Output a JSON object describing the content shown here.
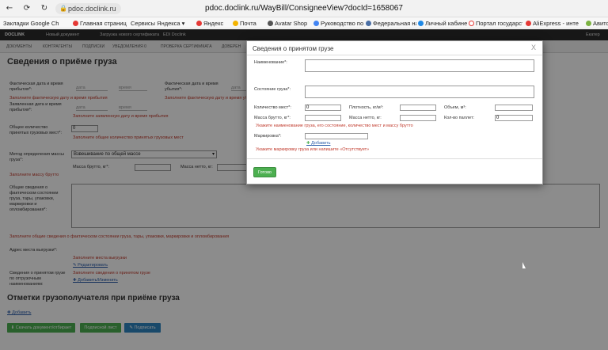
{
  "browser": {
    "host_badge": "pdoc.doclink.ru",
    "url": "pdoc.doclink.ru/WayBill/ConsigneeView?docId=1658067",
    "bookmarks": [
      {
        "label": "Закладки Google Ch",
        "color": "#ffffff"
      },
      {
        "label": "Главная страница",
        "color": "#e53935"
      },
      {
        "label": "Сервисы Яндекса",
        "color": "#ffffff"
      },
      {
        "label": "Яндекс",
        "color": "#e53935"
      },
      {
        "label": "Почта",
        "color": "#f4b400"
      },
      {
        "label": "Avatar Shop",
        "color": "#555555"
      },
      {
        "label": "Руководство по э",
        "color": "#4285f4"
      },
      {
        "label": "Федеральная нал",
        "color": "#4a6fa5"
      },
      {
        "label": "Личный кабинет",
        "color": "#1e88e5"
      },
      {
        "label": "Портал государст",
        "color": "#ffffff"
      },
      {
        "label": "AliExpress - инте",
        "color": "#e53935"
      },
      {
        "label": "Авито",
        "color": "#7cb342"
      }
    ]
  },
  "app": {
    "logo": "DOCLINK",
    "top_links": [
      "Новый документ",
      "Загрузка нового сертификата",
      "EDI Doclink"
    ],
    "user": "Екатер",
    "tabs": [
      "Документы",
      "Контрагенты",
      "Подписки",
      "Уведомления 0",
      "Проверка сертификата",
      "Доверен"
    ]
  },
  "page": {
    "title": "Сведения о приёме груза",
    "arrival_actual_label": "Фактическая дата и время прибытия*:",
    "date_ph": "дата",
    "time_ph": "время",
    "departure_actual_label": "Фактическая дата и время убытия*:",
    "err_arrival": "Заполните фактическую дату и время прибытия",
    "err_departure": "Заполните фактическую дату и время убытия",
    "declared_label": "Заявленная дата и время прибытия*:",
    "err_declared": "Заполните заявленную дату и время прибытия",
    "total_places_label": "Общее количество принятых грузовых мест*:",
    "total_places_value": "0",
    "err_places": "Заполните общее количество принятых грузовых мест",
    "mass_method_label": "Метод определения массы груза*:",
    "mass_method_value": "Взвешивание по общей массе",
    "gross_label": "Масса брутто, кг*:",
    "net_label": "Масса нетто, кг:",
    "err_mass": "Заполните массу брутто",
    "general_label": "Общие сведения о фактическом состоянии груза, тары, упаковки, маркировки и опломбирования*:",
    "err_general": "Заполните общие сведения о фактическом состоянии груза, тары, упаковки, маркировки и опломбирования",
    "unload_label": "Адрес места выгрузки*:",
    "err_unload": "Заполните места выгрузки",
    "edit_link": "Редактировать",
    "accepted_label": "Сведения о принятом грузе по отгрузочным наименованиям:",
    "err_accepted": "Заполните сведения о принятом грузе",
    "add_edit_link": "Добавить/Изменить",
    "section2_title": "Отметки грузополучателя при приёме груза",
    "add_link": "Добавить",
    "buttons": [
      "Скачать документ/отбирает",
      "Подписной лист",
      "Подписать"
    ]
  },
  "modal": {
    "title": "Сведения о принятом грузе",
    "close": "X",
    "name_label": "Наименование*:",
    "state_label": "Состояние груза*:",
    "qty_label": "Количество мест*:",
    "qty_value": "0",
    "density_label": "Плотность, кг/м³:",
    "volume_label": "Объем, м³:",
    "gross_label": "Масса брутто, кг*:",
    "net_label": "Масса нетто, кг:",
    "pallets_label": "Кол-во паллет:",
    "pallets_value": "0",
    "err_main": "Укажите наименование груза, его состояние, количество мест и массу брутто",
    "marking_label": "Маркировка*:",
    "add_link": "Добавить",
    "err_marking": "Укажите маркировку груза или напишите «Отсутствует»",
    "ok_button": "Готово"
  }
}
